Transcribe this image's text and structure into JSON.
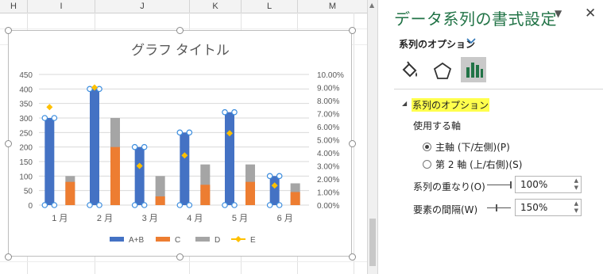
{
  "sheet": {
    "columns": [
      "H",
      "I",
      "J",
      "K",
      "L",
      "M"
    ]
  },
  "chart_data": {
    "type": "bar",
    "title": "グラフ タイトル",
    "categories": [
      "1 月",
      "2 月",
      "3 月",
      "4 月",
      "5 月",
      "6 月"
    ],
    "y_left_ticks": [
      "450",
      "400",
      "350",
      "300",
      "250",
      "200",
      "150",
      "100",
      "50",
      "0"
    ],
    "y_right_ticks": [
      "10.00%",
      "9.00%",
      "8.00%",
      "7.00%",
      "6.00%",
      "5.00%",
      "4.00%",
      "3.00%",
      "2.00%",
      "1.00%",
      "0.00%"
    ],
    "ylim_left": [
      0,
      450
    ],
    "ylim_right": [
      0,
      0.1
    ],
    "series": [
      {
        "name": "A+B",
        "type": "bar",
        "axis": "primary",
        "color": "#4472C4",
        "values": [
          300,
          400,
          200,
          250,
          320,
          100
        ]
      },
      {
        "name": "C",
        "type": "bar",
        "axis": "secondary",
        "color": "#ED7D31",
        "values": [
          80,
          200,
          30,
          70,
          80,
          45
        ]
      },
      {
        "name": "D",
        "type": "bar",
        "axis": "secondary",
        "color": "#A5A5A5",
        "values": [
          100,
          300,
          100,
          140,
          140,
          75
        ]
      },
      {
        "name": "E",
        "type": "line",
        "axis": "secondary",
        "color": "#FFC000",
        "values": [
          0.075,
          0.09,
          0.03,
          0.038,
          0.055,
          0.015
        ]
      }
    ],
    "legend_position": "bottom",
    "grid": true
  },
  "pane": {
    "title": "データ系列の書式設定",
    "options_label": "系列のオプション",
    "tabs": {
      "fill": "fill-line",
      "effects": "effects",
      "series": "series-options"
    },
    "section_title": "系列のオプション",
    "axis_heading": "使用する軸",
    "primary_axis": "主軸 (下/左側)(P)",
    "secondary_axis": "第 2 軸 (上/右側)(S)",
    "overlap_label": "系列の重なり(O)",
    "overlap_value": "100%",
    "gap_label": "要素の間隔(W)",
    "gap_value": "150%"
  }
}
